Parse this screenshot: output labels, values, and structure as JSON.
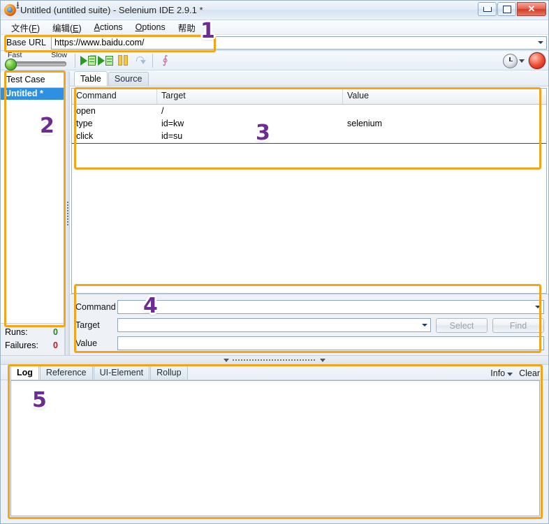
{
  "window": {
    "title": "Untitled (untitled suite) - Selenium IDE 2.9.1 *",
    "app_icon": "firefox-icon",
    "minimize_label": "–",
    "maximize_label": "□",
    "close_label": "✕"
  },
  "menu": {
    "items": [
      {
        "label": "文件(F)",
        "mnemonic": "F"
      },
      {
        "label": "编辑(E)",
        "mnemonic": "E"
      },
      {
        "label": "Actions",
        "mnemonic": "A"
      },
      {
        "label": "Options",
        "mnemonic": "O"
      },
      {
        "label": "帮助",
        "mnemonic": ""
      }
    ]
  },
  "base_url": {
    "label": "Base URL",
    "value": "https://www.baidu.com/",
    "placeholder": ""
  },
  "toolbar": {
    "speed_fast_label": "Fast",
    "speed_slow_label": "Slow",
    "speed_position": "fast",
    "buttons": [
      {
        "name": "play-entire-suite",
        "icon": "play-suite-icon",
        "enabled": true
      },
      {
        "name": "play-current-test-case",
        "icon": "play-test-icon",
        "enabled": true
      },
      {
        "name": "pause-resume",
        "icon": "pause-icon",
        "enabled": false
      },
      {
        "name": "step",
        "icon": "step-icon",
        "enabled": false
      },
      {
        "name": "apply-rollup-rules",
        "icon": "rollup-icon",
        "enabled": false
      }
    ],
    "speed_menu_icon": "clock-icon",
    "record_icon": "record-icon"
  },
  "test_case_panel": {
    "header": "Test Case",
    "items": [
      {
        "label": "Untitled *",
        "selected": true
      }
    ],
    "runs_label": "Runs:",
    "runs_value": "0",
    "failures_label": "Failures:",
    "failures_value": "0",
    "runs_color": "#1a8a1a",
    "failures_color": "#cc1111"
  },
  "editor": {
    "tabs": [
      {
        "label": "Table",
        "active": true
      },
      {
        "label": "Source",
        "active": false
      }
    ],
    "columns": [
      "Command",
      "Target",
      "Value"
    ],
    "rows": [
      {
        "command": "open",
        "target": "/",
        "value": ""
      },
      {
        "command": "type",
        "target": "id=kw",
        "value": "selenium"
      },
      {
        "command": "click",
        "target": "id=su",
        "value": ""
      }
    ]
  },
  "command_editor": {
    "command_label": "Command",
    "command_value": "",
    "target_label": "Target",
    "target_value": "",
    "value_label": "Value",
    "value_value": "",
    "select_button": "Select",
    "find_button": "Find"
  },
  "log_panel": {
    "tabs": [
      {
        "label": "Log",
        "active": true
      },
      {
        "label": "Reference",
        "active": false
      },
      {
        "label": "UI-Element",
        "active": false
      },
      {
        "label": "Rollup",
        "active": false
      }
    ],
    "info_label": "Info",
    "clear_label": "Clear",
    "content": ""
  },
  "annotations": {
    "accent_color": "#f2a41c",
    "badge_color": "#6b2d91",
    "badges": [
      {
        "number": "1",
        "target": "base-url-row"
      },
      {
        "number": "2",
        "target": "test-case-panel"
      },
      {
        "number": "3",
        "target": "command-table"
      },
      {
        "number": "4",
        "target": "command-editor"
      },
      {
        "number": "5",
        "target": "log-panel"
      }
    ]
  }
}
